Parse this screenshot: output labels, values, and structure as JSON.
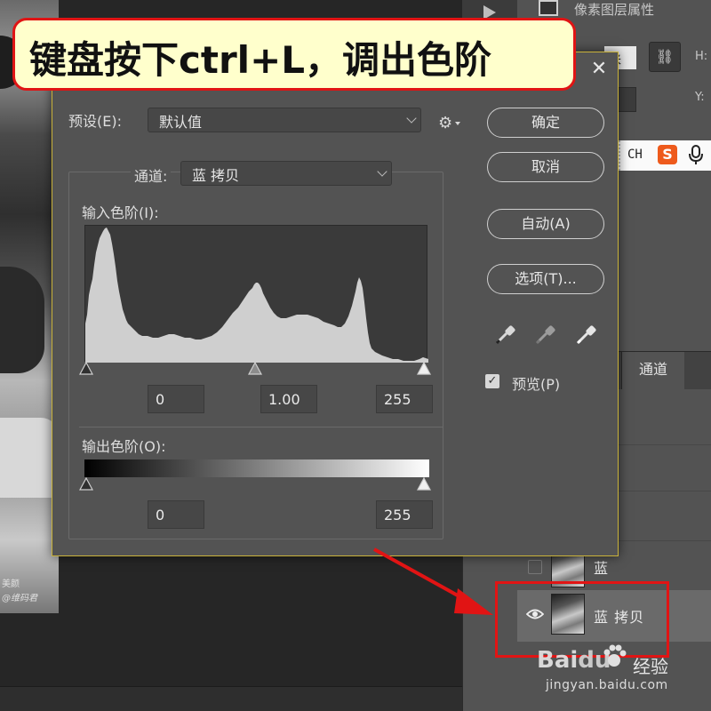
{
  "banner": {
    "text": "键盘按下ctrl+L，调出色阶"
  },
  "properties": {
    "title": "像素图层属性",
    "unit_value": "米",
    "h_label": "H:",
    "y_label": "Y:"
  },
  "ime": {
    "ch": "CH",
    "s_logo": "S"
  },
  "dialog": {
    "preset_label": "预设(E):",
    "preset_value": "默认值",
    "channel_label": "通道:",
    "channel_value": "蓝 拷贝",
    "input_levels_label": "输入色阶(I):",
    "input_black": "0",
    "input_gamma": "1.00",
    "input_white": "255",
    "output_levels_label": "输出色阶(O):",
    "output_black": "0",
    "output_white": "255",
    "buttons": {
      "ok": "确定",
      "cancel": "取消",
      "auto": "自动(A)",
      "options": "选项(T)..."
    },
    "preview_label": "预览(P)",
    "preview_checked": true
  },
  "channels_panel": {
    "tab_label": "通道",
    "rows": [
      {
        "name": "蓝",
        "visible": false
      },
      {
        "name": "蓝 拷贝",
        "visible": true,
        "selected": true
      }
    ]
  },
  "photo_watermark": {
    "line1": "美颜",
    "line2": "@维码君"
  },
  "watermark": {
    "baidu_bai": "Bai",
    "baidu_du": "du",
    "jingyan": "经验",
    "url": "jingyan.baidu.com"
  },
  "colors": {
    "banner_bg": "#ffffcc",
    "highlight_red": "#e11414",
    "dialog_border": "#c9b23a"
  }
}
